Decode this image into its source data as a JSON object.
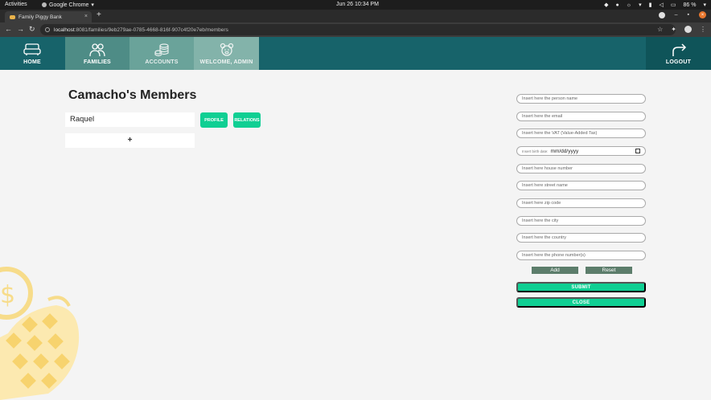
{
  "os": {
    "activities": "Activities",
    "app_name": "Google Chrome",
    "clock": "Jun 26  10:34 PM",
    "battery": "86 %"
  },
  "browser": {
    "tab_title": "Family Piggy Bank",
    "url_host": "localhost",
    "url_path": ":8081/families/9eb279ae-0785-4668-816f-907c4f20e7eb/members",
    "new_tab": "+",
    "profile_initial": "R"
  },
  "nav": {
    "home": "HOME",
    "families": "FAMILIES",
    "accounts": "ACCOUNTS",
    "welcome": "WELCOME, ADMIN",
    "logout": "LOGOUT"
  },
  "page": {
    "title": "Camacho's Members",
    "members": [
      {
        "name": "Raquel",
        "profile_label": "PROFILE",
        "relations_label": "RELATIONS"
      }
    ],
    "add_label": "+"
  },
  "form": {
    "person_name_placeholder": "Insert here the person name",
    "email_placeholder": "Insert here the email",
    "vat_placeholder": "Insert here the VAT (Value-Added Tax)",
    "birth_hint": "Insert birth date:",
    "birth_value": "mm/dd/yyyy",
    "house_number_placeholder": "Insert here house number",
    "street_placeholder": "Insert here street name",
    "zip_placeholder": "Insert here zip code",
    "city_placeholder": "Insert here the city",
    "country_placeholder": "Insert here the country",
    "phone_placeholder": "Insert here the phone number(s)",
    "add_label": "Add",
    "reset_label": "Reset",
    "submit_label": "SUBMIT",
    "close_label": "CLOSE"
  },
  "colors": {
    "nav_bg": "#17636a",
    "accent_green": "#0fcf93",
    "muted_button": "#5c7d6b",
    "decoration": "#f7dc8a"
  },
  "icons": [
    "sofa-icon",
    "people-icon",
    "coins-icon",
    "piggy-icon",
    "logout-arrow-icon"
  ]
}
